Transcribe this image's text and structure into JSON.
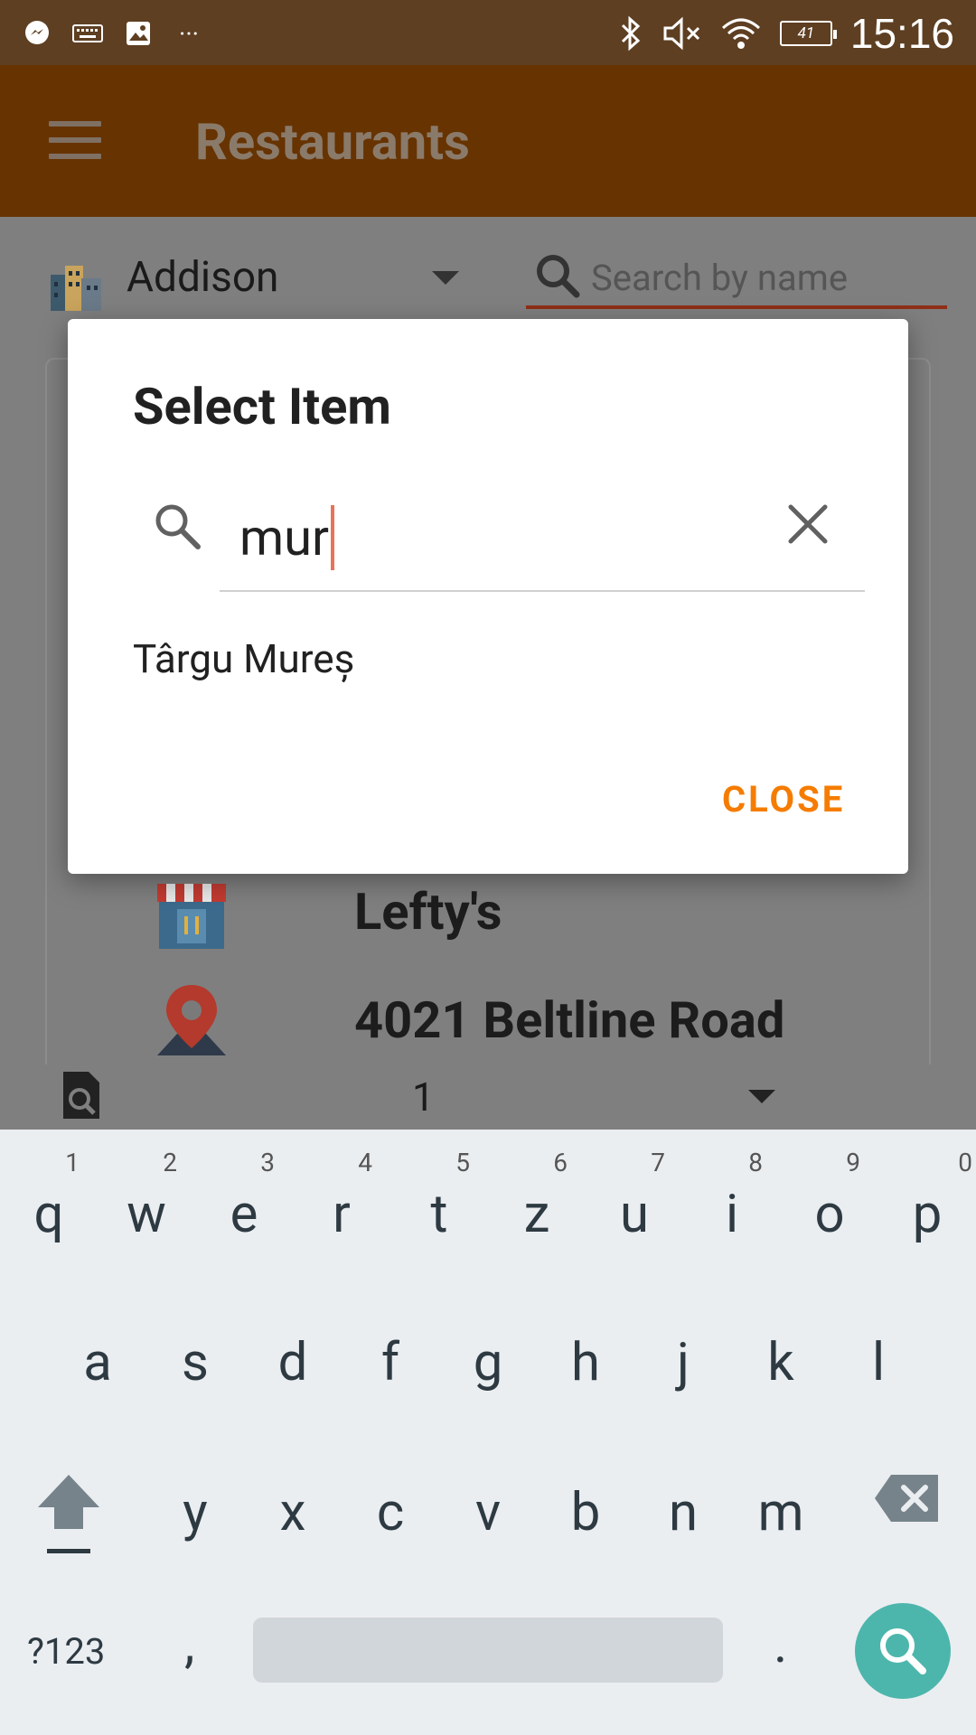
{
  "status_bar": {
    "battery": "41",
    "time": "15:16",
    "left_icons": [
      "messenger-icon",
      "keyboard-icon",
      "image-icon",
      "more-dots-icon"
    ],
    "right_icons": [
      "bluetooth-icon",
      "mute-icon",
      "wifi-icon",
      "battery-icon"
    ],
    "more": "···"
  },
  "appbar": {
    "title": "Restaurants",
    "menu_icon": "hamburger-menu-icon"
  },
  "filters": {
    "city": "Addison",
    "search_placeholder": "Search by name"
  },
  "restaurant": {
    "name": "Lefty's",
    "address": "4021 Beltline Road"
  },
  "pager": {
    "page": "1"
  },
  "dialog": {
    "title": "Select Item",
    "query": "mur",
    "results": [
      "Târgu Mureș"
    ],
    "close_label": "CLOSE"
  },
  "keyboard": {
    "row1": [
      {
        "key": "q",
        "hint": "1"
      },
      {
        "key": "w",
        "hint": "2"
      },
      {
        "key": "e",
        "hint": "3"
      },
      {
        "key": "r",
        "hint": "4"
      },
      {
        "key": "t",
        "hint": "5"
      },
      {
        "key": "z",
        "hint": "6"
      },
      {
        "key": "u",
        "hint": "7"
      },
      {
        "key": "i",
        "hint": "8"
      },
      {
        "key": "o",
        "hint": "9"
      },
      {
        "key": "p",
        "hint": "0"
      }
    ],
    "row2": [
      "a",
      "s",
      "d",
      "f",
      "g",
      "h",
      "j",
      "k",
      "l"
    ],
    "row3": [
      "y",
      "x",
      "c",
      "v",
      "b",
      "n",
      "m"
    ],
    "symbols_label": "?123",
    "comma": ",",
    "period": "."
  },
  "colors": {
    "status_bar": "#5e3f22",
    "app_bar": "#673300",
    "accent": "#f57c00",
    "keyboard_bg": "#ebeef1",
    "search_fab": "#4db6ac"
  }
}
